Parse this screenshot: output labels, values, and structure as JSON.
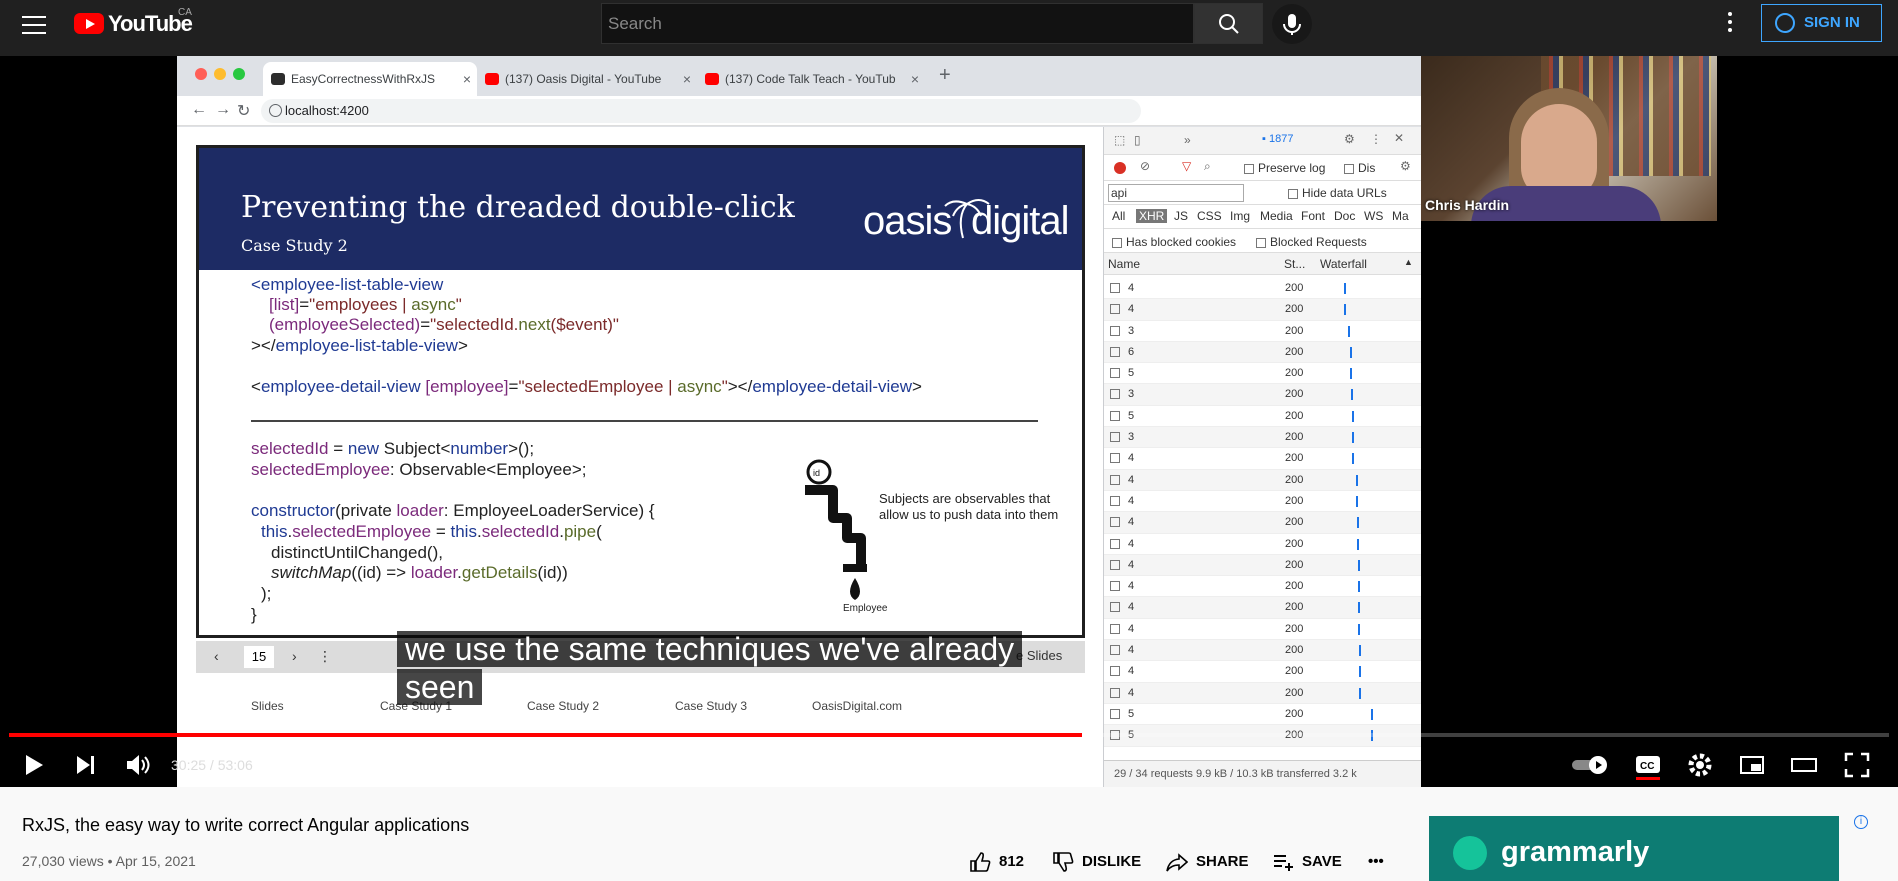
{
  "masthead": {
    "logo_text": "YouTube",
    "country": "CA",
    "search_placeholder": "Search",
    "signin_label": "SIGN IN"
  },
  "browser": {
    "tabs": [
      {
        "label": "EasyCorrectnessWithRxJS",
        "active": true
      },
      {
        "label": "(137) Oasis Digital - YouTube",
        "active": false
      },
      {
        "label": "(137) Code Talk Teach - YouTub",
        "active": false
      }
    ],
    "url": "localhost:4200"
  },
  "slide": {
    "title": "Preventing the dreaded double-click",
    "subtitle": "Case Study 2",
    "logo": "oasis digital",
    "note": "Subjects are observables that allow us to push data into them",
    "employee_label": "Employee",
    "page_number": "15",
    "nav_right": "e Slides",
    "links": [
      "Slides",
      "Case Study 1",
      "Case Study 2",
      "Case Study 3",
      "OasisDigital.com"
    ]
  },
  "devtools": {
    "message_count": "1877",
    "preserve_log": "Preserve log",
    "disable_cache": "Dis",
    "filter_value": "api",
    "hide_data_urls": "Hide data URLs",
    "types": [
      "All",
      "XHR",
      "JS",
      "CSS",
      "Img",
      "Media",
      "Font",
      "Doc",
      "WS",
      "Ma"
    ],
    "selected_type": "XHR",
    "has_blocked_cookies": "Has blocked cookies",
    "blocked_requests": "Blocked Requests",
    "columns": {
      "name": "Name",
      "status": "St...",
      "waterfall": "Waterfall"
    },
    "rows": [
      {
        "name": "4",
        "status": "200",
        "bar": 0.27
      },
      {
        "name": "4",
        "status": "200",
        "bar": 0.27
      },
      {
        "name": "3",
        "status": "200",
        "bar": 0.31
      },
      {
        "name": "6",
        "status": "200",
        "bar": 0.33
      },
      {
        "name": "5",
        "status": "200",
        "bar": 0.33
      },
      {
        "name": "3",
        "status": "200",
        "bar": 0.34
      },
      {
        "name": "5",
        "status": "200",
        "bar": 0.35
      },
      {
        "name": "3",
        "status": "200",
        "bar": 0.35
      },
      {
        "name": "4",
        "status": "200",
        "bar": 0.36
      },
      {
        "name": "4",
        "status": "200",
        "bar": 0.4
      },
      {
        "name": "4",
        "status": "200",
        "bar": 0.4
      },
      {
        "name": "4",
        "status": "200",
        "bar": 0.41
      },
      {
        "name": "4",
        "status": "200",
        "bar": 0.41
      },
      {
        "name": "4",
        "status": "200",
        "bar": 0.42
      },
      {
        "name": "4",
        "status": "200",
        "bar": 0.42
      },
      {
        "name": "4",
        "status": "200",
        "bar": 0.42
      },
      {
        "name": "4",
        "status": "200",
        "bar": 0.42
      },
      {
        "name": "4",
        "status": "200",
        "bar": 0.43
      },
      {
        "name": "4",
        "status": "200",
        "bar": 0.43
      },
      {
        "name": "4",
        "status": "200",
        "bar": 0.43
      },
      {
        "name": "5",
        "status": "200",
        "bar": 0.57
      },
      {
        "name": "5",
        "status": "200",
        "bar": 0.57
      }
    ],
    "footer": "29 / 34 requests   9.9 kB / 10.3 kB transferred   3.2 k"
  },
  "webcam": {
    "name": "Chris Hardin"
  },
  "caption": {
    "line1": "we use the same techniques we've already",
    "line2": "seen"
  },
  "player": {
    "time": "30:25 / 53:06",
    "progress": 0.571
  },
  "video": {
    "title": "RxJS, the easy way to write correct Angular applications",
    "meta": "27,030 views • Apr 15, 2021",
    "likes": "812",
    "dislike_label": "DISLIKE",
    "share_label": "SHARE",
    "save_label": "SAVE"
  },
  "ad": {
    "text": "grammarly"
  },
  "colors": {
    "accent": "#ff0000",
    "link": "#3ea6ff",
    "slide_header": "#1d2b64"
  }
}
